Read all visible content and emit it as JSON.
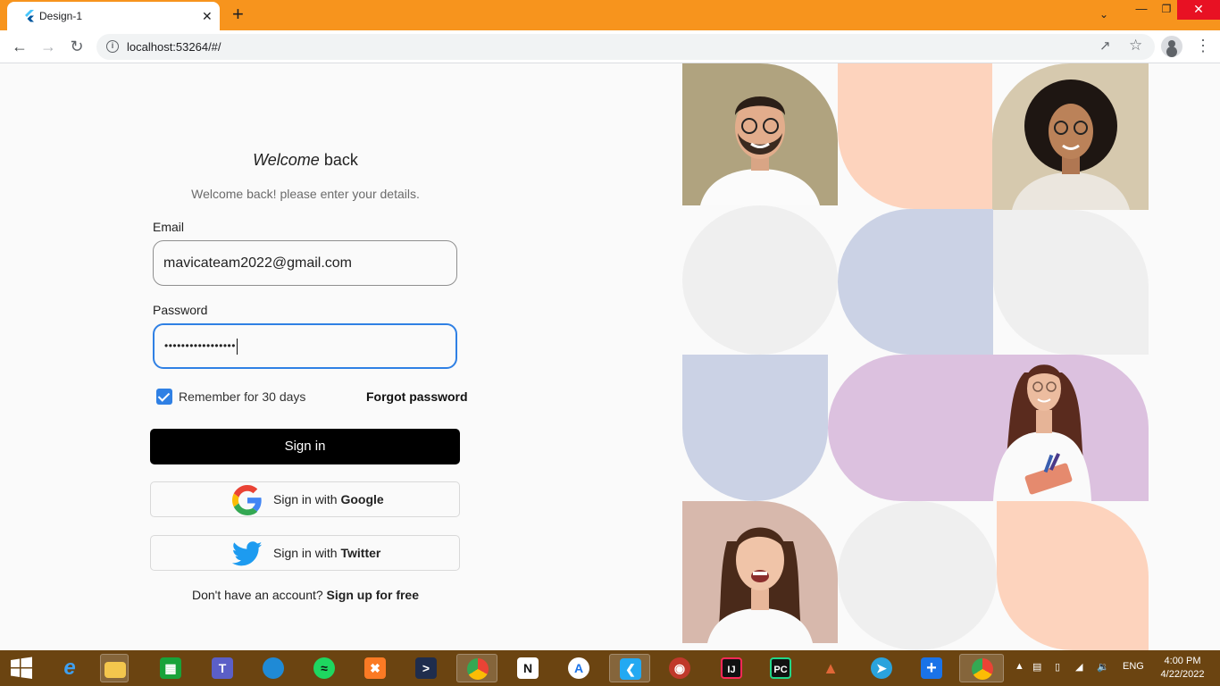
{
  "browser": {
    "tab_title": "Design-1",
    "tab_close": "✕",
    "new_tab": "+",
    "url": "localhost:53264/#/",
    "icons": [
      "flutter-icon",
      "back-icon",
      "forward-icon",
      "reload-icon",
      "info-icon",
      "share-icon",
      "star-icon",
      "profile-icon",
      "menu-icon"
    ]
  },
  "window_controls": {
    "minimize": "—",
    "restore": "❐",
    "close": "✕",
    "tab_search": "⌄"
  },
  "login": {
    "title_italic": "Welcome",
    "title_rest": " back",
    "subtitle": "Welcome back! please enter your details.",
    "email_label": "Email",
    "email_value": "mavicateam2022@gmail.com",
    "password_label": "Password",
    "password_value": "•••••••••••••••••",
    "remember_label": "Remember for 30 days",
    "remember_checked": true,
    "forgot_password": "Forgot password",
    "sign_in": "Sign in",
    "google_prefix": "Sign in with ",
    "google_brand": "Google",
    "twitter_prefix": "Sign in with ",
    "twitter_brand": "Twitter",
    "signup_prompt": "Don't have an account? ",
    "signup_link": "Sign up for free"
  },
  "colors": {
    "accent": "#2f80e4",
    "button": "#000000",
    "tab_bar": "#f7941d",
    "tile_peach": "#fdd3bd",
    "tile_lavender": "#cbd2e5",
    "tile_grey": "#efefef",
    "tile_purple": "#dcc1df",
    "tile_khaki": "#b0a37f",
    "tile_beige": "#d6c9ae",
    "tile_rose": "#d7b8ac"
  },
  "taskbar": {
    "apps": [
      "windows-start-icon",
      "internet-explorer-icon",
      "file-explorer-icon",
      "microsoft-store-icon",
      "teams-icon",
      "edge-icon",
      "spotify-icon",
      "xampp-icon",
      "powershell-icon",
      "chrome-icon",
      "notion-icon",
      "android-studio-icon",
      "vscode-icon",
      "owl-app-icon",
      "intellij-icon",
      "pycharm-icon",
      "matlab-icon",
      "telegram-icon",
      "plus-app-icon",
      "chrome-icon"
    ],
    "tray_language": "ENG",
    "clock_time": "4:00 PM",
    "clock_date": "4/22/2022"
  }
}
